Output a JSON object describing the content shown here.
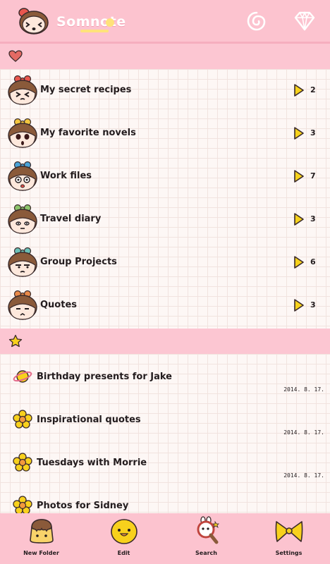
{
  "app": {
    "name": "Somnote"
  },
  "header": {
    "refresh_icon": "swirl-refresh-icon",
    "premium_icon": "diamond-icon"
  },
  "sections": {
    "folders_icon": "heart-icon",
    "notes_icon": "star-icon"
  },
  "folders": [
    {
      "name": "My secret recipes",
      "count": "2",
      "bow": "#e9564e",
      "face": "squint"
    },
    {
      "name": "My favorite novels",
      "count": "3",
      "bow": "#f3c640",
      "face": "surprised"
    },
    {
      "name": "Work files",
      "count": "7",
      "bow": "#4aa3d8",
      "face": "shocked"
    },
    {
      "name": "Travel diary",
      "count": "3",
      "bow": "#8cc46c",
      "face": "plain"
    },
    {
      "name": "Group Projects",
      "count": "6",
      "bow": "#6cc1b7",
      "face": "grumpy"
    },
    {
      "name": "Quotes",
      "count": "3",
      "bow": "#e98a4a",
      "face": "sad"
    }
  ],
  "notes": [
    {
      "title": "Birthday presents for Jake",
      "date": "2014. 8. 17.",
      "icon": "planet-icon"
    },
    {
      "title": "Inspirational quotes",
      "date": "2014. 8. 17.",
      "icon": "flower-icon"
    },
    {
      "title": "Tuesdays with Morrie",
      "date": "2014. 8. 17.",
      "icon": "flower-icon"
    },
    {
      "title": "Photos for Sidney",
      "date": "",
      "icon": "flower-icon"
    }
  ],
  "toolbar": {
    "new_folder": "New Folder",
    "edit": "Edit",
    "search": "Search",
    "settings": "Settings"
  },
  "colors": {
    "header_pink": "#fcc3cf",
    "arrow_yellow": "#f7d21b",
    "flower_yellow": "#f8d11c"
  }
}
